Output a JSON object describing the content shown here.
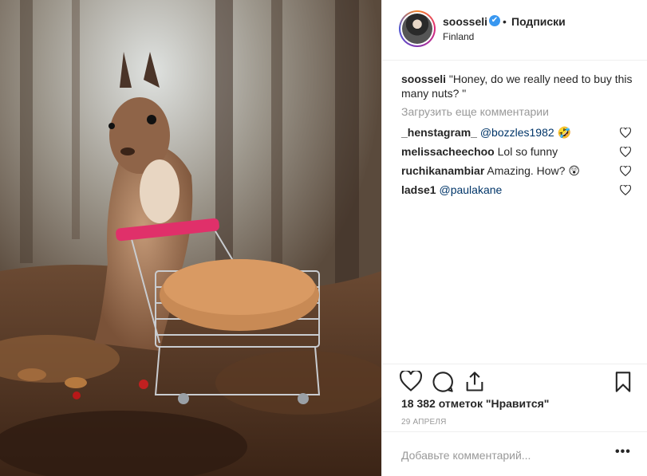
{
  "post": {
    "image_alt": "squirrel with shopping cart of nuts",
    "username": "soosseli",
    "follow_label": "Подписки",
    "separator": "•",
    "location": "Finland",
    "verified_glyph": "✔"
  },
  "caption": {
    "username": "soosseli",
    "text": "\"Honey, do we really need to buy this many nuts? \""
  },
  "load_more": "Загрузить еще комментарии",
  "comments": [
    {
      "user": "_henstagram_",
      "text": "@bozzles1982 🤣",
      "is_mention": true
    },
    {
      "user": "melissacheechoo",
      "text": "Lol so funny",
      "is_mention": false
    },
    {
      "user": "ruchikanambiar",
      "text": "Amazing. How? 😲",
      "is_mention": false
    },
    {
      "user": "ladse1",
      "text": "@paulakane",
      "is_mention": true
    }
  ],
  "likes": "18 382 отметок \"Нравится\"",
  "date": "29 АПРЕЛЯ",
  "add_comment_placeholder": "Добавьте комментарий...",
  "more_options": "•••",
  "icons": {
    "like": "heart-icon",
    "comment": "comment-icon",
    "share": "share-icon",
    "save": "bookmark-icon"
  },
  "colors": {
    "verified": "#3897f0",
    "mention": "#003569",
    "muted": "#999999",
    "border": "#efefef",
    "cart_handle": "#e0306a"
  }
}
